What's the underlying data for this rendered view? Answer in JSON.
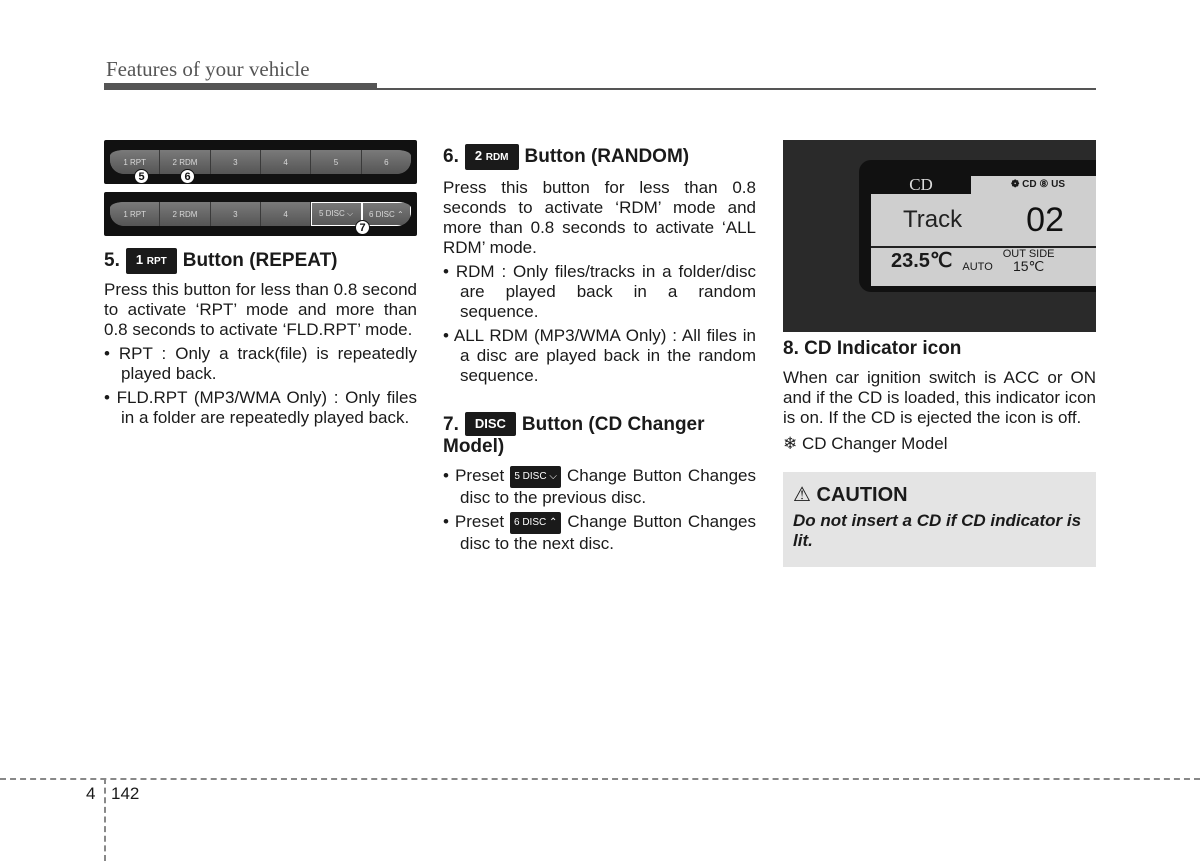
{
  "header": {
    "title": "Features of your vehicle"
  },
  "figure_left": {
    "panel1_buttons": [
      "1 RPT",
      "2 RDM",
      "3",
      "4",
      "5",
      "6"
    ],
    "panel2_buttons": [
      "1 RPT",
      "2 RDM",
      "3",
      "4",
      "5 DISC ⌵",
      "6 DISC ⌃"
    ],
    "callouts": [
      "5",
      "6",
      "7"
    ]
  },
  "section5": {
    "number": "5.",
    "badge_main": "1",
    "badge_sub": "RPT",
    "title": "Button (REPEAT)",
    "body": "Press this button for less than 0.8 second to activate ‘RPT’ mode and more than 0.8 seconds to activate ‘FLD.RPT’ mode.",
    "bullets": [
      "RPT : Only a track(file) is repeatedly played back.",
      "FLD.RPT (MP3/WMA Only) : Only files in a folder are repeatedly played back."
    ]
  },
  "section6": {
    "number": "6.",
    "badge_main": "2",
    "badge_sub": "RDM",
    "title": "Button (RANDOM)",
    "body": "Press this button for less than 0.8 seconds to activate ‘RDM’ mode and more than 0.8 seconds to activate ‘ALL RDM’ mode.",
    "bullets": [
      "RDM : Only files/tracks in a folder/disc are played back in a random sequence.",
      "ALL RDM (MP3/WMA Only) : All files in a disc are played back in the random sequence."
    ]
  },
  "section7": {
    "number": "7.",
    "badge": "DISC",
    "title": "Button (CD Changer Model)",
    "bullets": [
      {
        "pre": "Preset",
        "badge": "5 DISC ⌵",
        "post": "Change Button Changes disc to the previous disc."
      },
      {
        "pre": "Preset",
        "badge": "6 DISC ⌃",
        "post": "Change Button Changes disc to the next disc."
      }
    ]
  },
  "display": {
    "mode": "CD",
    "icons": "❁ CD ⑧ US",
    "track_label": "Track",
    "track_number": "02",
    "temp": "23.5℃",
    "auto": "AUTO",
    "outside_label": "OUT SIDE",
    "outside_temp": "15℃"
  },
  "section8": {
    "title": "8. CD Indicator icon",
    "body": "When car ignition switch is ACC or ON and if the CD is loaded, this indicator icon is on. If the CD is ejected the icon is off.",
    "note": "❄ CD Changer Model"
  },
  "caution": {
    "icon": "⚠",
    "title": "CAUTION",
    "body": "Do not insert a CD if CD indicator is lit."
  },
  "footer": {
    "chapter": "4",
    "page": "142"
  }
}
